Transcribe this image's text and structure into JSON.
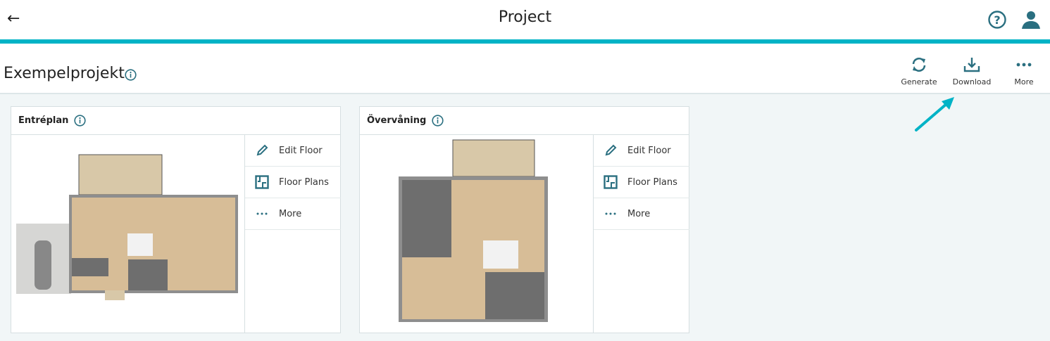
{
  "header": {
    "title": "Project",
    "back_icon": "arrow-left-icon",
    "help_icon": "question-circle-icon",
    "user_icon": "user-icon"
  },
  "project": {
    "name": "Exempelprojekt",
    "info_icon": "info-icon"
  },
  "toolbar": [
    {
      "label": "Generate",
      "icon": "sync-icon"
    },
    {
      "label": "Download",
      "icon": "download-icon"
    },
    {
      "label": "More",
      "icon": "more-horizontal-icon"
    }
  ],
  "floors": [
    {
      "name": "Entréplan",
      "menu": [
        {
          "label": "Edit Floor",
          "icon": "pencil-icon"
        },
        {
          "label": "Floor Plans",
          "icon": "floor-plan-icon"
        },
        {
          "label": "More",
          "icon": "more-horizontal-icon"
        }
      ]
    },
    {
      "name": "Övervåning",
      "menu": [
        {
          "label": "Edit Floor",
          "icon": "pencil-icon"
        },
        {
          "label": "Floor Plans",
          "icon": "floor-plan-icon"
        },
        {
          "label": "More",
          "icon": "more-horizontal-icon"
        }
      ]
    }
  ],
  "colors": {
    "accent": "#00b3c6",
    "icon": "#2a6f80"
  }
}
